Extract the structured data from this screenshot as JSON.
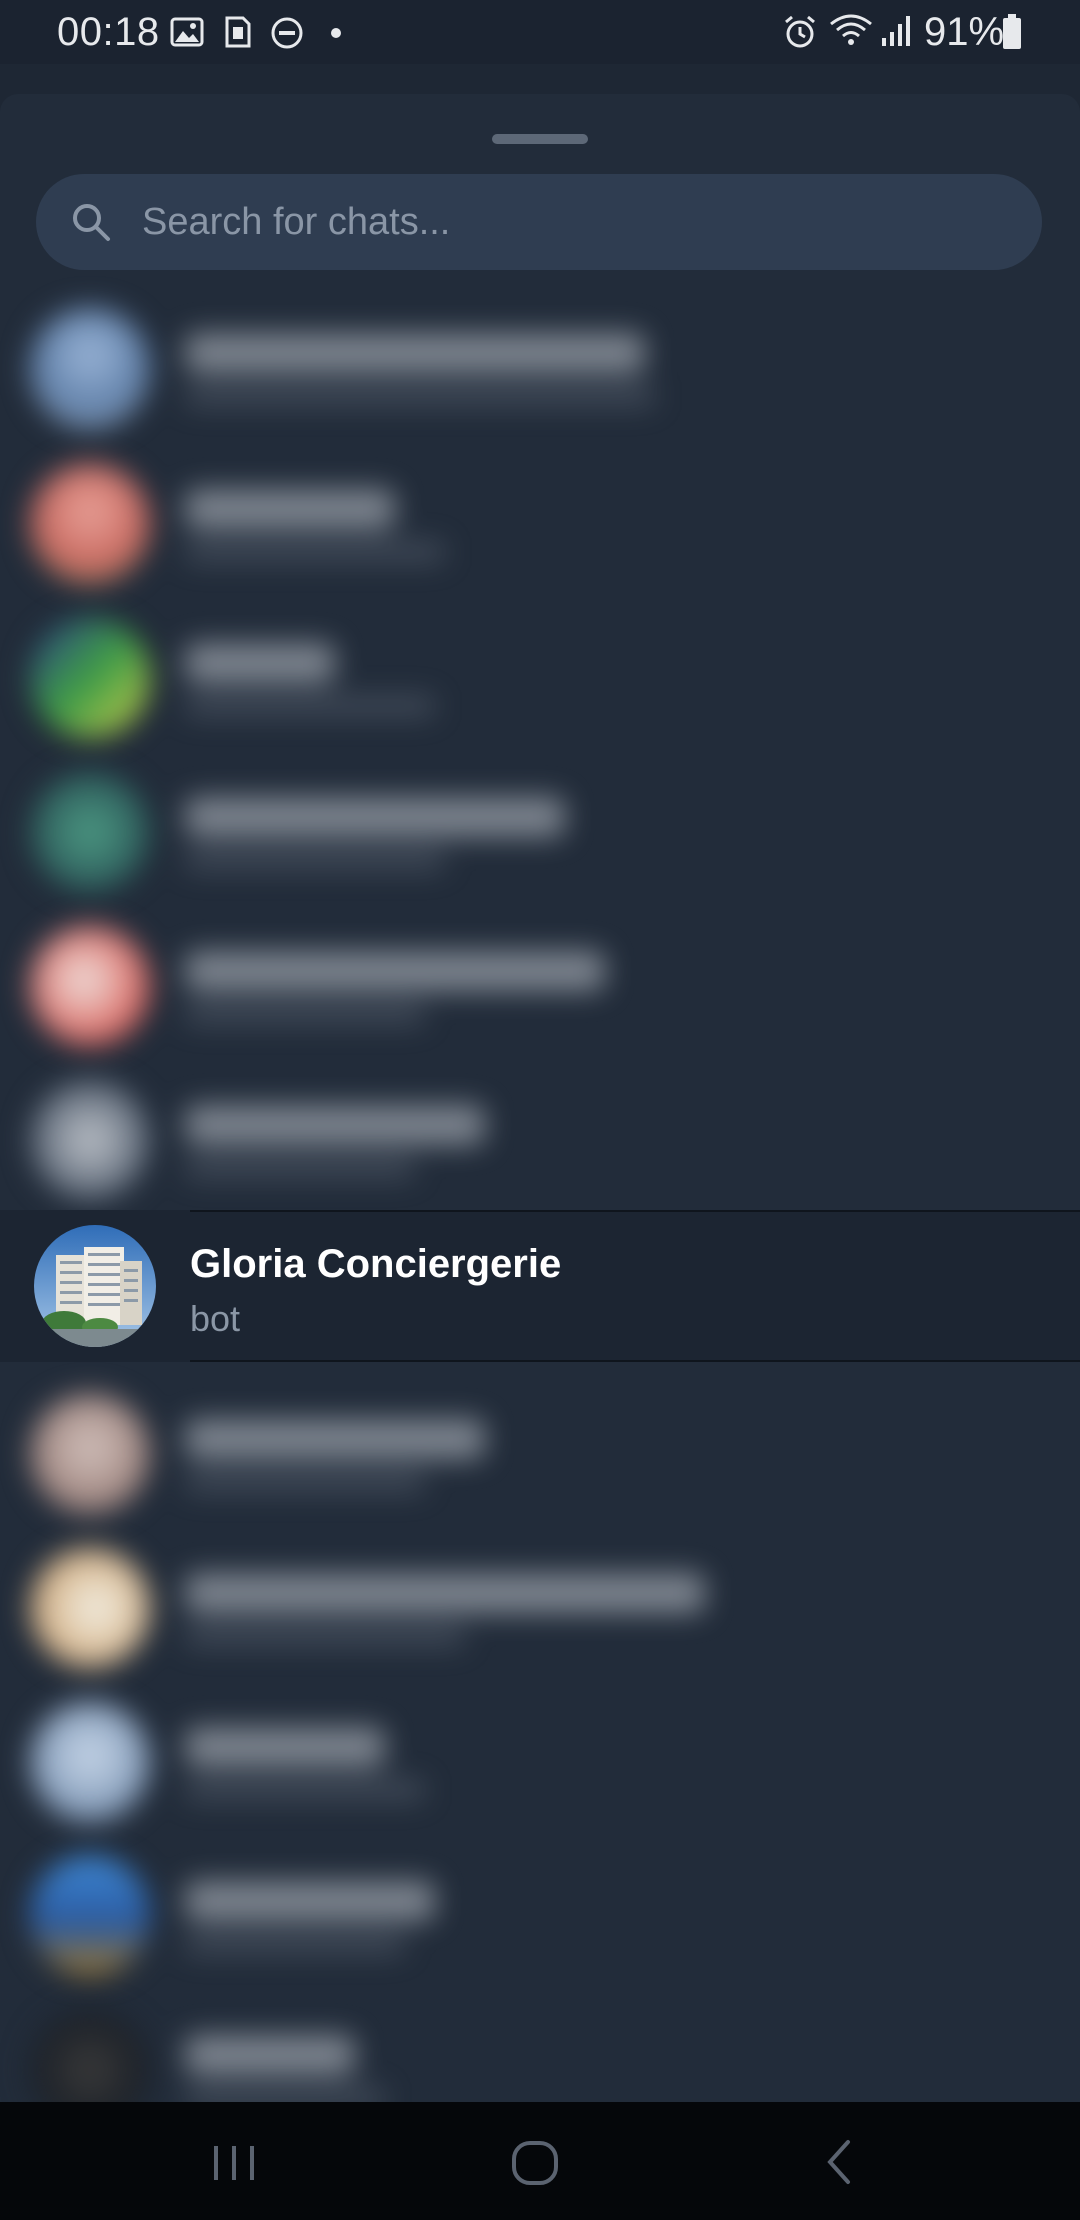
{
  "status_bar": {
    "time": "00:18",
    "battery_percent": "91%",
    "left_icons": [
      "gallery-icon",
      "sim-card-icon",
      "do-not-disturb-icon",
      "dot-icon"
    ],
    "right_icons": [
      "alarm-icon",
      "wifi-icon",
      "signal-icon",
      "battery-icon"
    ]
  },
  "search": {
    "placeholder": "Search for chats...",
    "value": ""
  },
  "focused_chat": {
    "name": "Gloria Conciergerie",
    "subtitle": "bot"
  },
  "nav_bar": {
    "buttons": [
      "recents-icon",
      "home-icon",
      "back-icon"
    ]
  },
  "colors": {
    "background": "#1e2734",
    "sheet": "#222c3a",
    "search_field": "#2f3d51",
    "placeholder": "#8a96a6",
    "subtitle": "#8b97a6"
  }
}
